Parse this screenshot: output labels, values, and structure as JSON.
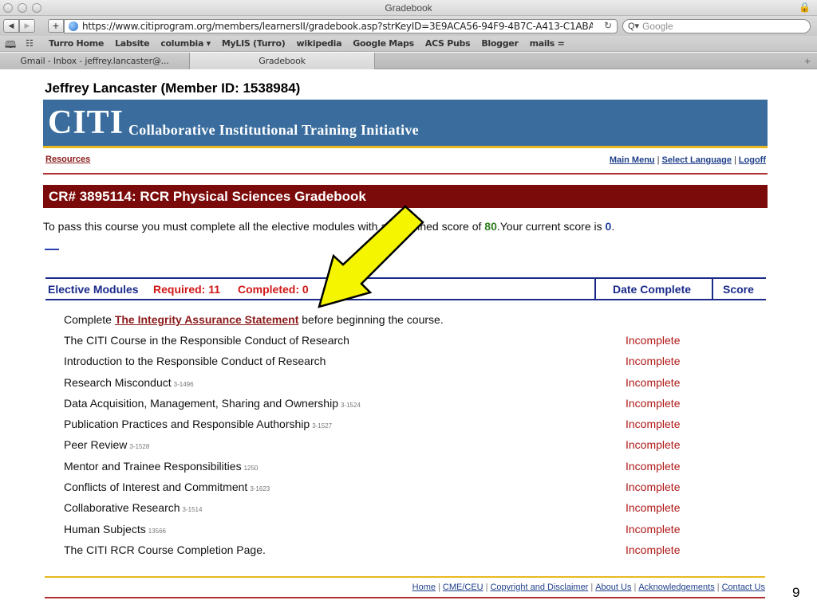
{
  "browser": {
    "window_title": "Gradebook",
    "url": "https://www.citiprogram.org/members/learnersII/gradebook.asp?strKeyID=3E9ACA56-94F9-4B7C-A413-C1ABA16",
    "search_placeholder": "Google",
    "bookmarks": [
      "Turro Home",
      "Labsite",
      "columbia ▾",
      "MyLIS (Turro)",
      "wikipedia",
      "Google Maps",
      "ACS Pubs",
      "Blogger",
      "mails ="
    ],
    "tabs": [
      {
        "label": "Gmail - Inbox - jeffrey.lancaster@..."
      },
      {
        "label": "Gradebook"
      }
    ],
    "icons": {
      "back": "back-arrow-icon",
      "forward": "forward-arrow-icon",
      "add": "plus-icon",
      "site": "globe-icon",
      "reload": "reload-icon",
      "search": "magnifier-icon",
      "lock": "lock-icon",
      "bookmarks": "book-icon",
      "topsites": "grid-icon",
      "new_tab": "plus-icon"
    }
  },
  "page": {
    "member_title": "Jeffrey Lancaster (Member ID: 1538984)",
    "logo": "CITI",
    "logo_subtitle": "Collaborative Institutional Training Initiative",
    "resources_link": "Resources",
    "nav": {
      "main_menu": "Main Menu",
      "select_language": "Select Language",
      "logoff": "Logoff"
    },
    "gradebook_title": "CR# 3895114: RCR Physical Sciences Gradebook",
    "pass_text": {
      "prefix": "To pass this course you must complete all the elective modules with a combined score of ",
      "required_score": "80",
      "middle": ".Your current score is ",
      "current_score": "0",
      "suffix": "."
    },
    "table_header": {
      "elective_modules": "Elective Modules",
      "required": "Required: 11",
      "completed": "Completed: 0",
      "date_complete": "Date Complete",
      "score": "Score"
    },
    "intro": {
      "prefix": "Complete ",
      "link": "The Integrity Assurance Statement",
      "suffix": " before beginning the course."
    },
    "modules": [
      {
        "name": "The CITI Course in the Responsible Conduct of Research",
        "id": "",
        "status": "Incomplete"
      },
      {
        "name": "Introduction to the Responsible Conduct of Research",
        "id": "",
        "status": "Incomplete"
      },
      {
        "name": "Research Misconduct",
        "id": "3-1496",
        "status": "Incomplete"
      },
      {
        "name": "Data Acquisition, Management, Sharing and Ownership",
        "id": "3-1524",
        "status": "Incomplete"
      },
      {
        "name": "Publication Practices and Responsible Authorship",
        "id": "3-1527",
        "status": "Incomplete"
      },
      {
        "name": "Peer Review",
        "id": "3-1528",
        "status": "Incomplete"
      },
      {
        "name": "Mentor and Trainee Responsibilities",
        "id": "1250",
        "status": "Incomplete"
      },
      {
        "name": "Conflicts of Interest and Commitment",
        "id": "3-1623",
        "status": "Incomplete"
      },
      {
        "name": "Collaborative Research",
        "id": "3-1514",
        "status": "Incomplete"
      },
      {
        "name": "Human Subjects",
        "id": "13566",
        "status": "Incomplete"
      },
      {
        "name": "The CITI RCR Course Completion Page.",
        "id": "",
        "status": "Incomplete"
      }
    ],
    "footer_links": [
      "Home",
      "CME/CEU",
      "Copyright and Disclaimer",
      "About Us",
      "Acknowledgements",
      "Contact Us"
    ]
  },
  "slide_number": "9",
  "colors": {
    "banner_blue": "#3a6d9e",
    "gradebook_red": "#7b0a0a",
    "header_blue": "#1a2a8a",
    "status_red": "#b01818",
    "arrow_yellow": "#f5f500"
  }
}
